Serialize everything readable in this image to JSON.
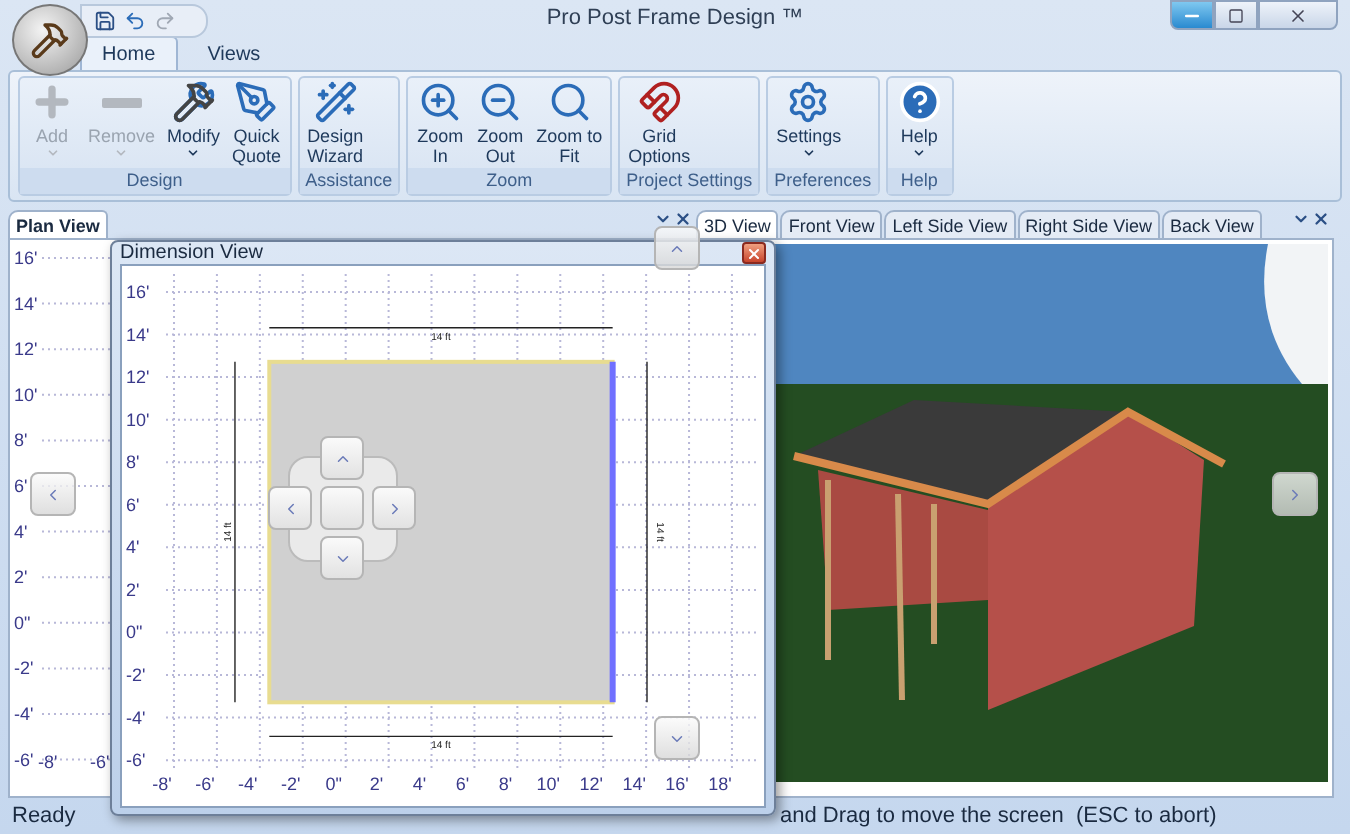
{
  "window": {
    "title": "Pro Post Frame Design ™"
  },
  "ribbon": {
    "tabs": [
      {
        "label": "Home",
        "selected": true
      },
      {
        "label": "Views",
        "selected": false
      }
    ],
    "groups": [
      {
        "label": "Design",
        "buttons": [
          {
            "label": "Add",
            "kind": "plus",
            "disabled": true,
            "dropdown": true
          },
          {
            "label": "Remove",
            "kind": "minus",
            "disabled": true,
            "dropdown": true
          },
          {
            "label": "Modify",
            "kind": "tools",
            "disabled": false,
            "dropdown": true
          },
          {
            "label": "Quick\nQuote",
            "kind": "pen",
            "disabled": false,
            "dropdown": false
          }
        ]
      },
      {
        "label": "Assistance",
        "buttons": [
          {
            "label": "Design\nWizard",
            "kind": "wand",
            "disabled": false,
            "dropdown": false
          }
        ]
      },
      {
        "label": "Zoom",
        "buttons": [
          {
            "label": "Zoom\nIn",
            "kind": "zoom_in",
            "disabled": false,
            "dropdown": false
          },
          {
            "label": "Zoom\nOut",
            "kind": "zoom_out",
            "disabled": false,
            "dropdown": false
          },
          {
            "label": "Zoom to\nFit",
            "kind": "zoom_fit",
            "disabled": false,
            "dropdown": false
          }
        ]
      },
      {
        "label": "Project Settings",
        "buttons": [
          {
            "label": "Grid\nOptions",
            "kind": "magnet",
            "disabled": false,
            "dropdown": false
          }
        ]
      },
      {
        "label": "Preferences",
        "buttons": [
          {
            "label": "Settings",
            "kind": "gear",
            "disabled": false,
            "dropdown": true
          }
        ]
      },
      {
        "label": "Help",
        "buttons": [
          {
            "label": "Help",
            "kind": "help",
            "disabled": false,
            "dropdown": true
          }
        ]
      }
    ]
  },
  "plan_view": {
    "tab": "Plan View",
    "y_labels": [
      "16'",
      "14'",
      "12'",
      "10'",
      "8'",
      "6'",
      "4'",
      "2'",
      "0\"",
      "-2'",
      "-4'",
      "-6'"
    ],
    "x_labels": [
      "-8'",
      "-6'"
    ]
  },
  "view_tabs": [
    {
      "label": "3D View",
      "selected": true
    },
    {
      "label": "Front View",
      "selected": false
    },
    {
      "label": "Left Side View",
      "selected": false
    },
    {
      "label": "Right Side View",
      "selected": false
    },
    {
      "label": "Back View",
      "selected": false
    }
  ],
  "dimension_view": {
    "title": "Dimension View",
    "y_labels": [
      "16'",
      "14'",
      "12'",
      "10'",
      "8'",
      "6'",
      "4'",
      "2'",
      "0\"",
      "-2'",
      "-4'",
      "-6'"
    ],
    "x_labels": [
      "-8'",
      "-6'",
      "-4'",
      "-2'",
      "0\"",
      "2'",
      "4'",
      "6'",
      "8'",
      "10'",
      "12'",
      "14'",
      "16'",
      "18'"
    ],
    "dimensions": {
      "top": "14 ft",
      "bottom": "14 ft",
      "left": "14 ft",
      "right": "14 ft"
    }
  },
  "status_bar": {
    "left": "Ready",
    "right": "and Drag to move the screen  (ESC to abort)"
  }
}
